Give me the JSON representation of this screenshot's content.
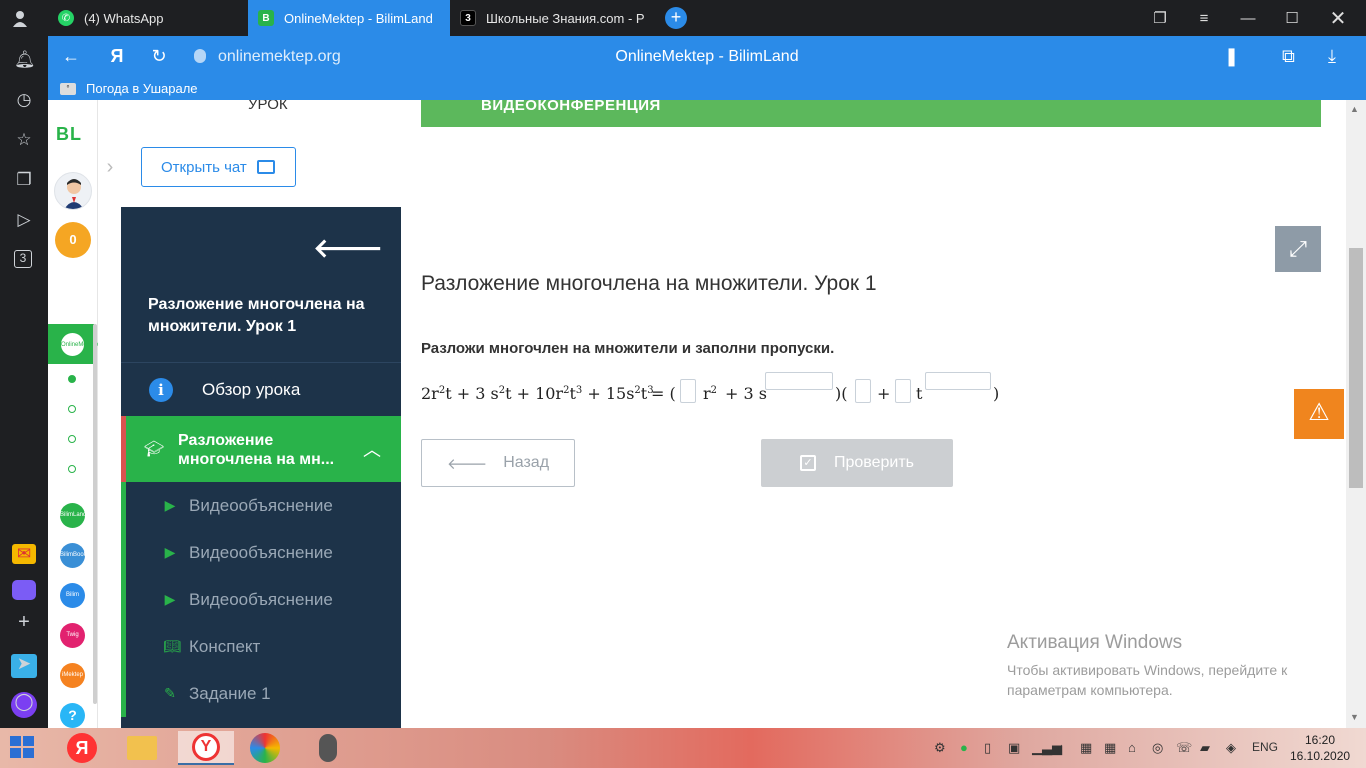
{
  "browser": {
    "tabs": [
      {
        "label": "(4) WhatsApp",
        "icon": "whatsapp-icon",
        "active": false
      },
      {
        "label": "OnlineMektep - BilimLand",
        "icon": "bilimland-icon",
        "active": true
      },
      {
        "label": "Школьные Знания.com - Р",
        "icon": "znanija-icon",
        "active": false
      }
    ],
    "url": "onlinemektep.org",
    "page_title": "OnlineMektep - BilimLand",
    "yandex_logo": "Я",
    "bookmark": "Погода в Ушарале"
  },
  "site": {
    "logo": "BL",
    "coins": "0",
    "lesson_tab": "УРОК",
    "videoconf": "ВИДЕОКОНФЕРЕНЦИЯ",
    "open_chat": "Открыть чат",
    "side_services": [
      "OnlineMektep",
      "BilimLand",
      "BilimBook",
      "Bilim",
      "Twig",
      "iMektep"
    ]
  },
  "menu": {
    "title": "Разложение многочлена на множители. Урок 1",
    "overview": "Обзор урока",
    "section": "Разложение многочлена на мн...",
    "items": [
      {
        "label": "Видеообъяснение",
        "icon": "play-icon"
      },
      {
        "label": "Видеообъяснение",
        "icon": "play-icon"
      },
      {
        "label": "Видеообъяснение",
        "icon": "play-icon"
      },
      {
        "label": "Конспект",
        "icon": "book-icon"
      },
      {
        "label": "Задание 1",
        "icon": "edit-icon"
      }
    ]
  },
  "content": {
    "title": "Разложение многочлена на множители. Урок 1",
    "instruction": "Разложи многочлен на множители и заполни пропуски.",
    "equation": {
      "lhs": [
        "2r",
        "2",
        "t + 3 s",
        "2",
        "t + 10r",
        "2",
        "t",
        "3",
        " + 15s",
        "2",
        "t",
        "3"
      ],
      "eq_sign": "= (",
      "p1_var": "r",
      "p1_exp": "2",
      "p1_plus": "+ 3 s",
      "close_open": ")(",
      "plus": "+",
      "t_var": "t",
      "close": ")"
    },
    "back_button": "Назад",
    "check_button": "Проверить"
  },
  "windows_activation": {
    "title": "Активация Windows",
    "text": "Чтобы активировать Windows, перейдите к параметрам компьютера."
  },
  "taskbar": {
    "language": "ENG",
    "time": "16:20",
    "date": "16.10.2020"
  },
  "colors": {
    "browser_blue": "#2b8be8",
    "menu_dark": "#1d3349",
    "green": "#29b34a",
    "orange": "#f0851e"
  }
}
